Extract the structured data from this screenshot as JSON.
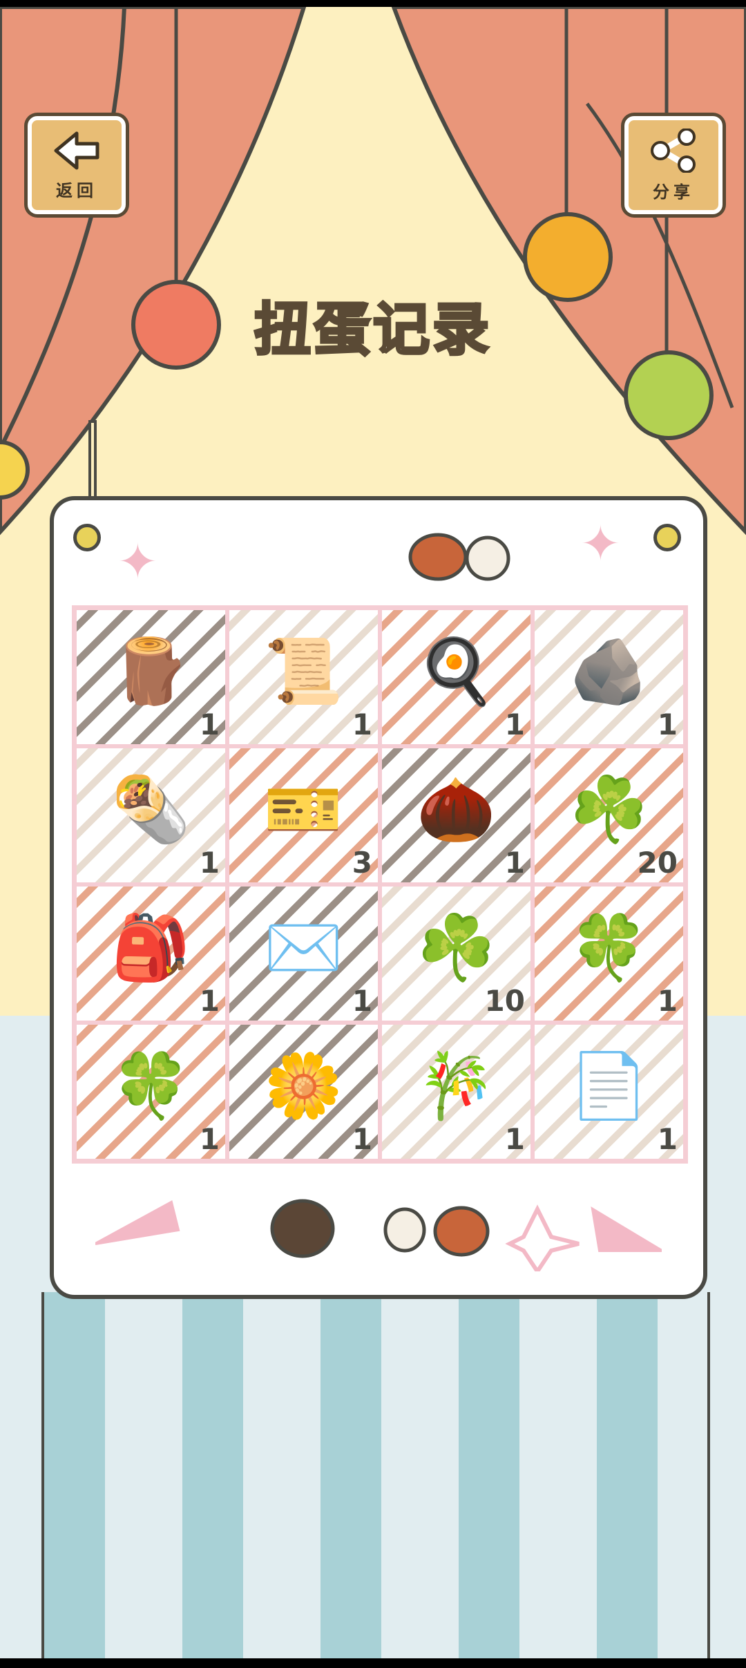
{
  "header": {
    "back_label": "返回",
    "share_label": "分享",
    "title": "扭蛋记录"
  },
  "icons": {
    "back": "arrow-left-icon",
    "share": "share-icon"
  },
  "items": [
    {
      "name": "wood-stack",
      "count": "1",
      "hatch": "#9b8f86"
    },
    {
      "name": "scroll-bundle",
      "count": "1",
      "hatch": "#e8dcd0"
    },
    {
      "name": "omelette",
      "count": "1",
      "hatch": "#e7a68a"
    },
    {
      "name": "rock",
      "count": "1",
      "hatch": "#e8dcd0"
    },
    {
      "name": "crepe",
      "count": "1",
      "hatch": "#e8dcd0"
    },
    {
      "name": "ticket",
      "count": "3",
      "hatch": "#e7a68a"
    },
    {
      "name": "chestnut",
      "count": "1",
      "hatch": "#9b8f86"
    },
    {
      "name": "clover",
      "count": "20",
      "hatch": "#e7a68a"
    },
    {
      "name": "seed-bag",
      "count": "1",
      "hatch": "#e7a68a"
    },
    {
      "name": "cat-letter",
      "count": "1",
      "hatch": "#9b8f86"
    },
    {
      "name": "clover",
      "count": "10",
      "hatch": "#e8dcd0"
    },
    {
      "name": "four-leaf-clover",
      "count": "1",
      "hatch": "#e7a68a"
    },
    {
      "name": "four-leaf-clover",
      "count": "1",
      "hatch": "#e7a68a"
    },
    {
      "name": "plum-blossom",
      "count": "1",
      "hatch": "#9b8f86"
    },
    {
      "name": "bamboo",
      "count": "1",
      "hatch": "#e8dcd0"
    },
    {
      "name": "paper",
      "count": "1",
      "hatch": "#e8dcd0"
    }
  ],
  "item_glyphs": [
    "🪵",
    "📜",
    "🍳",
    "🪨",
    "🌯",
    "🎫",
    "🌰",
    "☘️",
    "🎒",
    "✉️",
    "☘️",
    "🍀",
    "🍀",
    "🌼",
    "🎋",
    "📄"
  ]
}
